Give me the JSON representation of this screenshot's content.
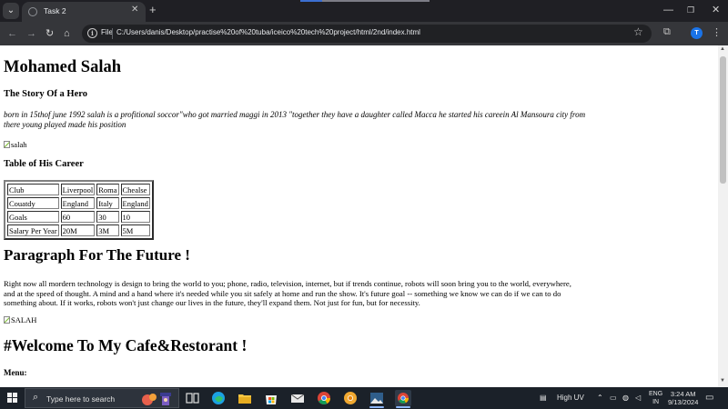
{
  "browser": {
    "tab_title": "Task 2",
    "chip_label": "File",
    "url": "C:/Users/danis/Desktop/practise%20of%20tuba/iceico%20tech%20project/html/2nd/index.html",
    "profile_initial": "T"
  },
  "page": {
    "heading": "Mohamed Salah",
    "story_heading": "The Story Of a Hero",
    "story_text": "born in 15thof june 1992 salah is a profitional soccor\"who got married maggi in 2013 \"together they have a daughter called Macca he started his careein Al Mansoura city from there young played made his position",
    "image1_alt": "salah",
    "table_heading": "Table of His Career",
    "table_rows": [
      [
        "Club",
        "Liverpool",
        "Roma",
        "Chealse"
      ],
      [
        "Couatdy",
        "England",
        "Italy",
        "England"
      ],
      [
        "Goals",
        "60",
        "30",
        "10"
      ],
      [
        "Salary Per Year",
        "20M",
        "3M",
        "5M"
      ]
    ],
    "future_heading": "Paragraph For The Future !",
    "future_text": "Right now all mordern technology is design to bring the world to you; phone, radio, television, internet, but if trends continue, robots will soon bring you to the world, everywhere, and at the speed of thought. A mind and a hand where it's needed while you sit safely at home and run the show. It's future goal -- something we know we can do if we can to do something about. If it works, robots won't just change our lives in the future, they'll expand them. Not just for fun, but for necessity.",
    "image2_alt": "SALAH",
    "cafe_heading": "#Welcome To My Cafe&Restorant !",
    "menu_label": "Menu:"
  },
  "taskbar": {
    "search_placeholder": "Type here to search",
    "weather": "High UV",
    "lang_line1": "ENG",
    "lang_line2": "IN",
    "time": "3:24 AM",
    "date": "9/13/2024"
  }
}
